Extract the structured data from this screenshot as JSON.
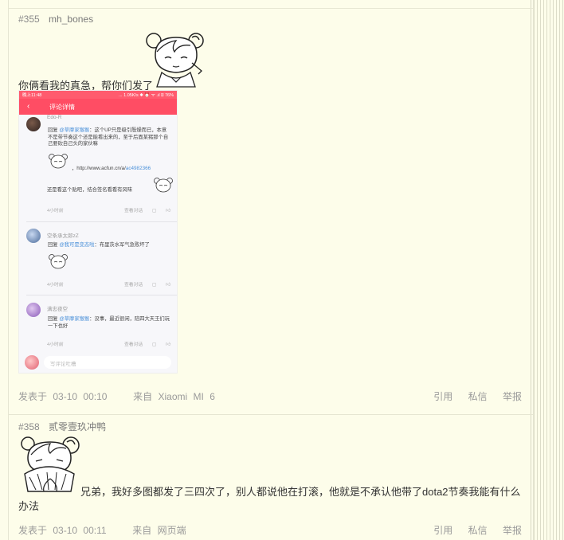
{
  "posts": [
    {
      "floor": "#355",
      "user": "mh_bones",
      "text": "你俩看我的真急，帮你们发了",
      "footer": {
        "posted_label": "发表于",
        "date": "03-10",
        "time": "00:10",
        "from_label": "来自",
        "device_words": [
          "Xiaomi",
          "MI",
          "6"
        ]
      },
      "actions": [
        "引用",
        "私信",
        "举报"
      ]
    },
    {
      "floor": "#358",
      "user": "贰零壹玖冲鸭",
      "text_line1": "兄弟，我好多图都发了三四次了，别人都说他在打滚，他就是不承认他带了dota2节奏我能有什么",
      "text_line2": "办法",
      "footer": {
        "posted_label": "发表于",
        "date": "03-10",
        "time": "00:11",
        "from_label": "来自",
        "device": "网页端"
      },
      "actions": [
        "引用",
        "私信",
        "举报"
      ]
    }
  ],
  "screenshot": {
    "status_left": "晚上11:48",
    "status_right": "... 1.05K/s ✱ ⏰ ᯤ .ıl ⌸ 76%",
    "nav_title": "评论详情",
    "comments": [
      {
        "name": "Edo-R",
        "reply_prefix": "回复 ",
        "mention": "@草摩家猴猴",
        "body": "：这个UP只是级引殷燥而已，本意不是带节奏这个还是能看出来的，至于后面某猪那个自己要砍自己头的家伙嘛",
        "link_prefix": "，http://www.acfun.cn/a/",
        "link_tail": "ac4982366",
        "body2": "还是看这个贴吧，结合签名看看有风味",
        "time": "4小时前",
        "view": "查看对话"
      },
      {
        "name": "空条承太郎zZ",
        "reply_prefix": "回复 ",
        "mention": "@我可是变态啦",
        "body": "：布里茨水军气急败坏了",
        "time": "4小时前",
        "view": "查看对话"
      },
      {
        "name": "满忠夜空",
        "reply_prefix": "回复 ",
        "mention": "@草摩家猴猴",
        "body": "：没事，最近很闲，陪四大天王们玩一下也好",
        "time": "4小时前",
        "view": "查看对话"
      }
    ],
    "composer_placeholder": "写评论吐槽"
  },
  "colors": {
    "page_bg": "#fdfdea",
    "accent_red": "#ff4d64",
    "mention_blue": "#4a90d9"
  }
}
